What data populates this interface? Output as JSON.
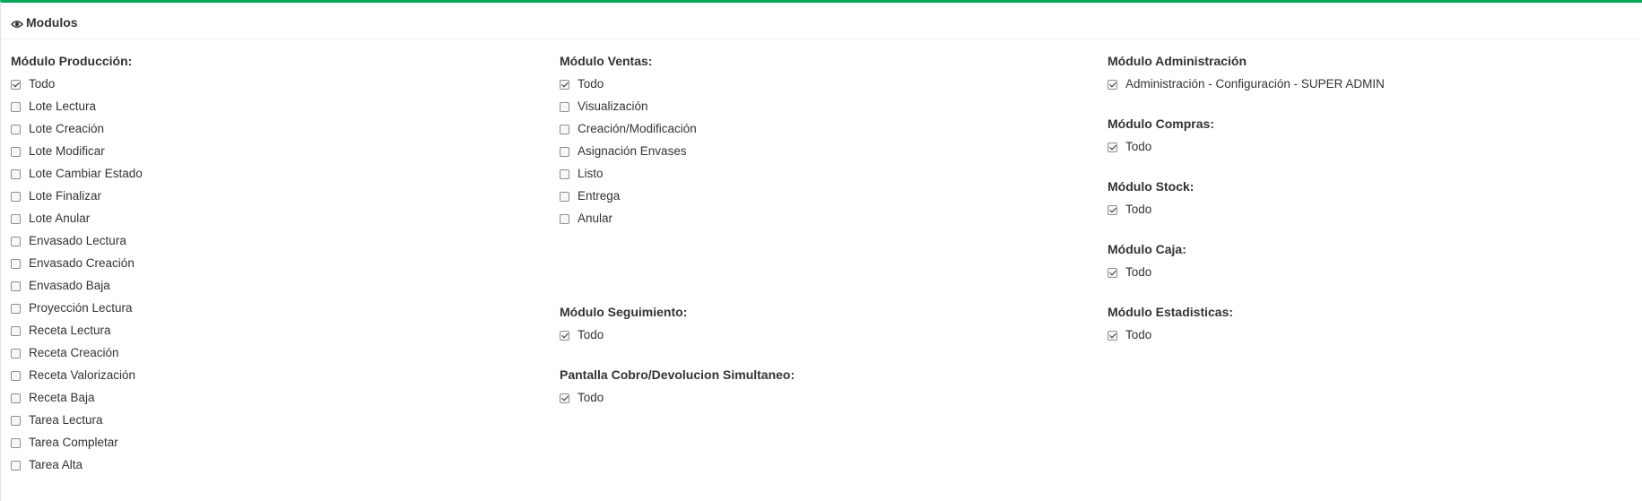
{
  "header": {
    "title": "Modulos",
    "icon": "eye-icon"
  },
  "columns": [
    {
      "sections": [
        {
          "title": "Módulo Producción:",
          "items": [
            {
              "label": "Todo",
              "checked": true
            },
            {
              "label": "Lote Lectura",
              "checked": false
            },
            {
              "label": "Lote Creación",
              "checked": false
            },
            {
              "label": "Lote Modificar",
              "checked": false
            },
            {
              "label": "Lote Cambiar Estado",
              "checked": false
            },
            {
              "label": "Lote Finalizar",
              "checked": false
            },
            {
              "label": "Lote Anular",
              "checked": false
            },
            {
              "label": "Envasado Lectura",
              "checked": false
            },
            {
              "label": "Envasado Creación",
              "checked": false
            },
            {
              "label": "Envasado Baja",
              "checked": false
            },
            {
              "label": "Proyección Lectura",
              "checked": false
            },
            {
              "label": "Receta Lectura",
              "checked": false
            },
            {
              "label": "Receta Creación",
              "checked": false
            },
            {
              "label": "Receta Valorización",
              "checked": false
            },
            {
              "label": "Receta Baja",
              "checked": false
            },
            {
              "label": "Tarea Lectura",
              "checked": false
            },
            {
              "label": "Tarea Completar",
              "checked": false
            },
            {
              "label": "Tarea Alta",
              "checked": false
            }
          ]
        }
      ]
    },
    {
      "sections": [
        {
          "title": "Módulo Ventas:",
          "items": [
            {
              "label": "Todo",
              "checked": true
            },
            {
              "label": "Visualización",
              "checked": false
            },
            {
              "label": "Creación/Modificación",
              "checked": false
            },
            {
              "label": "Asignación Envases",
              "checked": false
            },
            {
              "label": "Listo",
              "checked": false
            },
            {
              "label": "Entrega",
              "checked": false
            },
            {
              "label": "Anular",
              "checked": false
            }
          ]
        },
        {
          "title": "Módulo Seguimiento:",
          "items": [
            {
              "label": "Todo",
              "checked": true
            }
          ]
        },
        {
          "title": "Pantalla Cobro/Devolucion Simultaneo:",
          "items": [
            {
              "label": "Todo",
              "checked": true
            }
          ]
        }
      ]
    },
    {
      "sections": [
        {
          "title": "Módulo Administración",
          "items": [
            {
              "label": "Administración - Configuración - SUPER ADMIN",
              "checked": true
            }
          ]
        },
        {
          "title": "Módulo Compras:",
          "items": [
            {
              "label": "Todo",
              "checked": true
            }
          ]
        },
        {
          "title": "Módulo Stock:",
          "items": [
            {
              "label": "Todo",
              "checked": true
            }
          ]
        },
        {
          "title": "Módulo Caja:",
          "items": [
            {
              "label": "Todo",
              "checked": true
            }
          ]
        },
        {
          "title": "Módulo Estadisticas:",
          "items": [
            {
              "label": "Todo",
              "checked": true
            }
          ]
        }
      ]
    }
  ]
}
